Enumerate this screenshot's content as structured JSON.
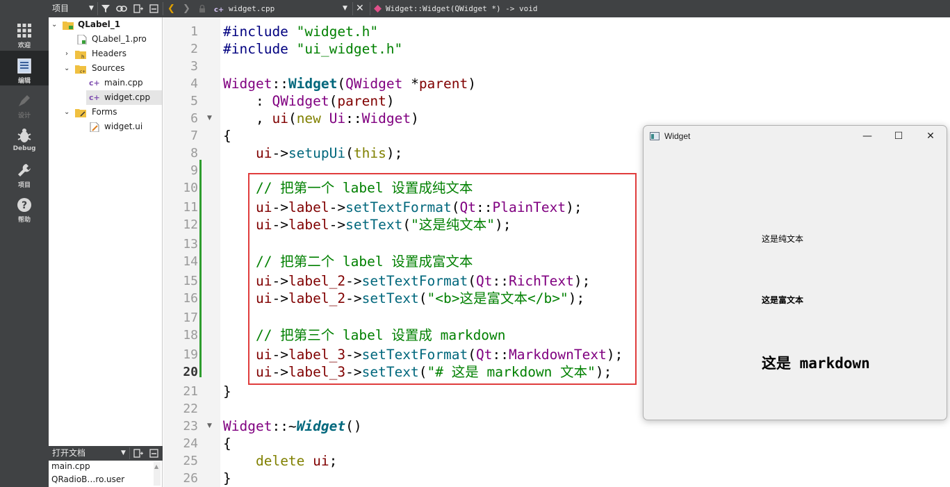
{
  "modes": [
    {
      "label": "欢迎",
      "icon": "grid-icon",
      "active": false
    },
    {
      "label": "编辑",
      "icon": "edit-document-icon",
      "active": true
    },
    {
      "label": "设计",
      "icon": "pen-icon",
      "active": false
    },
    {
      "label": "Debug",
      "icon": "bug-icon",
      "active": false
    },
    {
      "label": "项目",
      "icon": "wrench-icon",
      "active": false
    },
    {
      "label": "帮助",
      "icon": "help-icon",
      "active": false
    }
  ],
  "toolbar": {
    "projects_label": "项目",
    "file_name": "widget.cpp",
    "symbol": "Widget::Widget(QWidget *) -> void"
  },
  "tree": {
    "project": "QLabel_1",
    "pro_file": "QLabel_1.pro",
    "headers": "Headers",
    "sources": "Sources",
    "main_cpp": "main.cpp",
    "widget_cpp": "widget.cpp",
    "forms": "Forms",
    "widget_ui": "widget.ui"
  },
  "open_docs": {
    "label": "打开文档",
    "items": [
      "main.cpp",
      "QRadioB…ro.user"
    ]
  },
  "editor": {
    "current_line": 20,
    "lines": [
      "#include \"widget.h\"",
      "#include \"ui_widget.h\"",
      "",
      "Widget::Widget(QWidget *parent)",
      "    : QWidget(parent)",
      "    , ui(new Ui::Widget)",
      "{",
      "    ui->setupUi(this);",
      "",
      "    // 把第一个 label 设置成纯文本",
      "    ui->label->setTextFormat(Qt::PlainText);",
      "    ui->label->setText(\"这是纯文本\");",
      "",
      "    // 把第二个 label 设置成富文本",
      "    ui->label_2->setTextFormat(Qt::RichText);",
      "    ui->label_2->setText(\"<b>这是富文本</b>\");",
      "",
      "    // 把第三个 label 设置成 markdown",
      "    ui->label_3->setTextFormat(Qt::MarkdownText);",
      "    ui->label_3->setText(\"# 这是 markdown 文本\");",
      "}",
      "",
      "Widget::~Widget()",
      "{",
      "    delete ui;",
      "}"
    ]
  },
  "widget_window": {
    "title": "Widget",
    "plain_text": "这是纯文本",
    "rich_text": "这是富文本",
    "markdown_text": "这是 markdown"
  }
}
